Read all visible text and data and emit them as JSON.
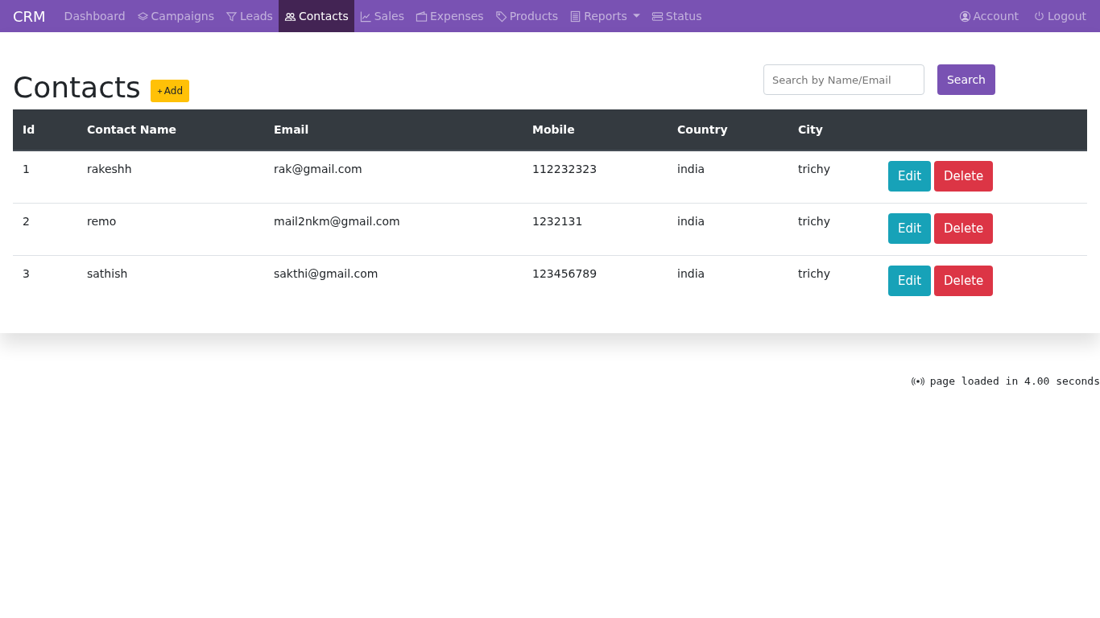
{
  "navbar": {
    "brand": "CRM",
    "items": [
      {
        "label": "Dashboard",
        "selected": false,
        "dropdown": false
      },
      {
        "label": "Campaigns",
        "selected": false,
        "dropdown": false
      },
      {
        "label": "Leads",
        "selected": false,
        "dropdown": false
      },
      {
        "label": "Contacts",
        "selected": true,
        "dropdown": false
      },
      {
        "label": "Sales",
        "selected": false,
        "dropdown": false
      },
      {
        "label": "Expenses",
        "selected": false,
        "dropdown": false
      },
      {
        "label": "Products",
        "selected": false,
        "dropdown": false
      },
      {
        "label": "Reports",
        "selected": false,
        "dropdown": true
      },
      {
        "label": "Status",
        "selected": false,
        "dropdown": false
      }
    ],
    "right_items": [
      {
        "label": "Account"
      },
      {
        "label": "Logout"
      }
    ]
  },
  "page": {
    "title": "Contacts",
    "add_button": "Add",
    "search": {
      "placeholder": "Search by Name/Email"
    },
    "search_button": "Search"
  },
  "table": {
    "columns": [
      "Id",
      "Contact Name",
      "Email",
      "Mobile",
      "Country",
      "City"
    ],
    "rows": [
      {
        "cells": [
          "1",
          "rakeshh",
          "rak@gmail.com",
          "112232323",
          "india",
          "trichy"
        ],
        "actions": [
          "Edit",
          "Delete"
        ]
      },
      {
        "cells": [
          "2",
          "remo",
          "mail2nkm@gmail.com",
          "1232131",
          "india",
          "trichy"
        ],
        "actions": [
          "Edit",
          "Delete"
        ]
      },
      {
        "cells": [
          "3",
          "sathish",
          "sakthi@gmail.com",
          "123456789",
          "india",
          "trichy"
        ],
        "actions": [
          "Edit",
          "Delete"
        ]
      }
    ]
  },
  "footer": {
    "text": "page loaded in 4.00 seconds"
  }
}
